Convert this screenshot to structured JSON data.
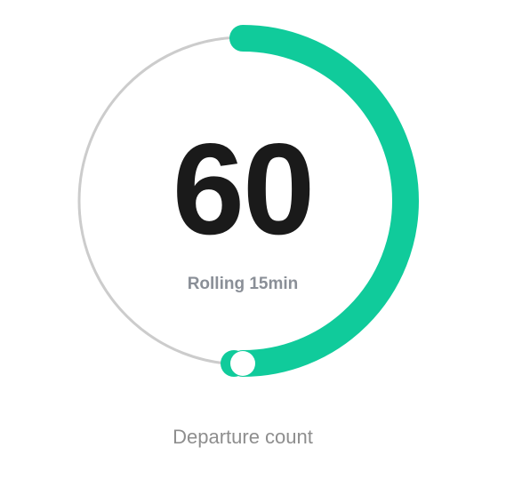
{
  "gauge": {
    "value": "60",
    "caption": "Rolling 15min",
    "label": "Departure count",
    "fill_fraction": 0.5,
    "colors": {
      "progress": "#10cb9b",
      "track": "#cccccc",
      "value_text": "#1a1a1a",
      "caption_text": "#8a8f97",
      "label_text": "#8e8e8e"
    }
  }
}
